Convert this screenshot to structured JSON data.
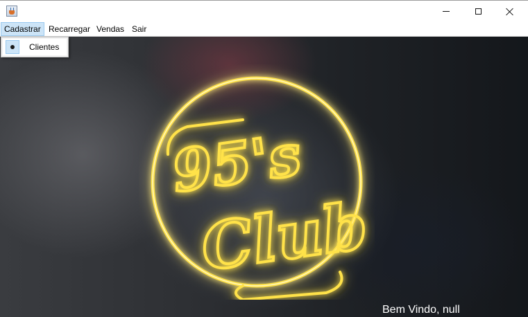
{
  "window": {
    "title": "",
    "icon": "java-cup-icon",
    "controls": [
      "minimize-icon",
      "maximize-icon",
      "close-icon"
    ]
  },
  "menubar": {
    "items": [
      {
        "label": "Cadastrar",
        "active": true
      },
      {
        "label": "Recarregar",
        "active": false
      },
      {
        "label": "Vendas",
        "active": false
      },
      {
        "label": "Sair",
        "active": false
      }
    ]
  },
  "popup": {
    "items": [
      {
        "label": "Clientes",
        "icon": "radio-bullet-icon"
      }
    ]
  },
  "logo": {
    "line1": "95's",
    "line2": "Club",
    "neon_color": "#ffe24a"
  },
  "status": {
    "welcome": "Bem Vindo, null"
  },
  "colors": {
    "menu_highlight": "#cce4f7",
    "menu_highlight_border": "#99c9ef",
    "neon": "#ffe24a"
  }
}
